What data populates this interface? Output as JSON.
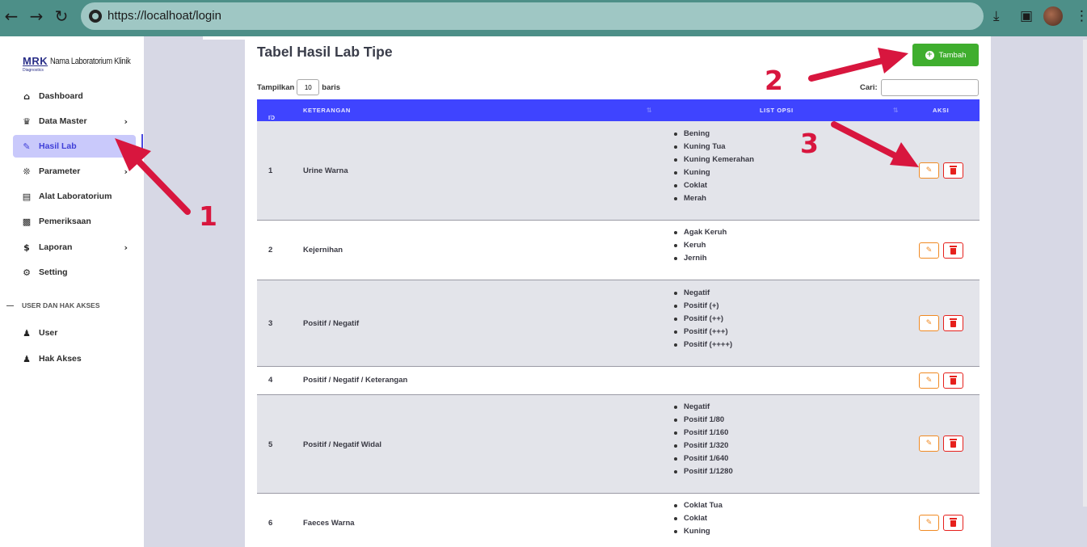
{
  "browser": {
    "url": "https://localhoat/login",
    "icons": [
      "back-icon",
      "forward-icon",
      "reload-icon",
      "site-info-icon",
      "download-icon",
      "side-panel-icon",
      "avatar",
      "more-icon"
    ]
  },
  "sidebar": {
    "logo_text": "MRK",
    "logo_sub": "Diagnostics",
    "app_name": "Nama Laboratorium Klinik",
    "items": [
      {
        "label": "Dashboard",
        "icon": "house-icon"
      },
      {
        "label": "Data Master",
        "icon": "crown-icon"
      },
      {
        "label": "Hasil Lab",
        "icon": "pen-icon"
      },
      {
        "label": "Parameter",
        "icon": "molecule-icon"
      },
      {
        "label": "Alat Laboratorium",
        "icon": "toolbox-icon"
      },
      {
        "label": "Pemeriksaan",
        "icon": "clinic-icon"
      },
      {
        "label": "Laporan",
        "icon": "hand-dollar-icon"
      },
      {
        "label": "Setting",
        "icon": "gear-icon"
      }
    ],
    "section": "USER DAN HAK AKSES",
    "items2": [
      {
        "label": "User",
        "icon": "users-icon"
      },
      {
        "label": "Hak Akses",
        "icon": "user-lock-icon"
      }
    ]
  },
  "main": {
    "title": "Tabel Hasil Lab Tipe",
    "add_button": "Tambah",
    "length_prefix": "Tampilkan",
    "length_value": "10",
    "length_suffix": "baris",
    "search_label": "Cari:",
    "columns": [
      "ID",
      "KETERANGAN",
      "LIST OPSI",
      "AKSI"
    ],
    "rows": [
      {
        "id": "1",
        "keterangan": "Urine Warna",
        "opsi": [
          "Bening",
          "Kuning Tua",
          "Kuning Kemerahan",
          "Kuning",
          "Coklat",
          "Merah"
        ]
      },
      {
        "id": "2",
        "keterangan": "Kejernihan",
        "opsi": [
          "Agak Keruh",
          "Keruh",
          "Jernih"
        ]
      },
      {
        "id": "3",
        "keterangan": "Positif / Negatif",
        "opsi": [
          "Negatif",
          "Positif (+)",
          "Positif (++)",
          "Positif (+++)",
          "Positif (++++)"
        ]
      },
      {
        "id": "4",
        "keterangan": "Positif / Negatif / Keterangan",
        "opsi": []
      },
      {
        "id": "5",
        "keterangan": "Positif / Negatif Widal",
        "opsi": [
          "Negatif",
          "Positif 1/80",
          "Positif 1/160",
          "Positif 1/320",
          "Positif 1/640",
          "Positif 1/1280"
        ]
      },
      {
        "id": "6",
        "keterangan": "Faeces Warna",
        "opsi": [
          "Coklat Tua",
          "Coklat",
          "Kuning"
        ]
      }
    ]
  },
  "annotations": [
    "1",
    "2",
    "3"
  ],
  "colors": {
    "accent": "#3f44ff",
    "add": "#3fae2e",
    "edit": "#f08a24",
    "delete": "#e6201c",
    "arrow": "#d8163e"
  }
}
